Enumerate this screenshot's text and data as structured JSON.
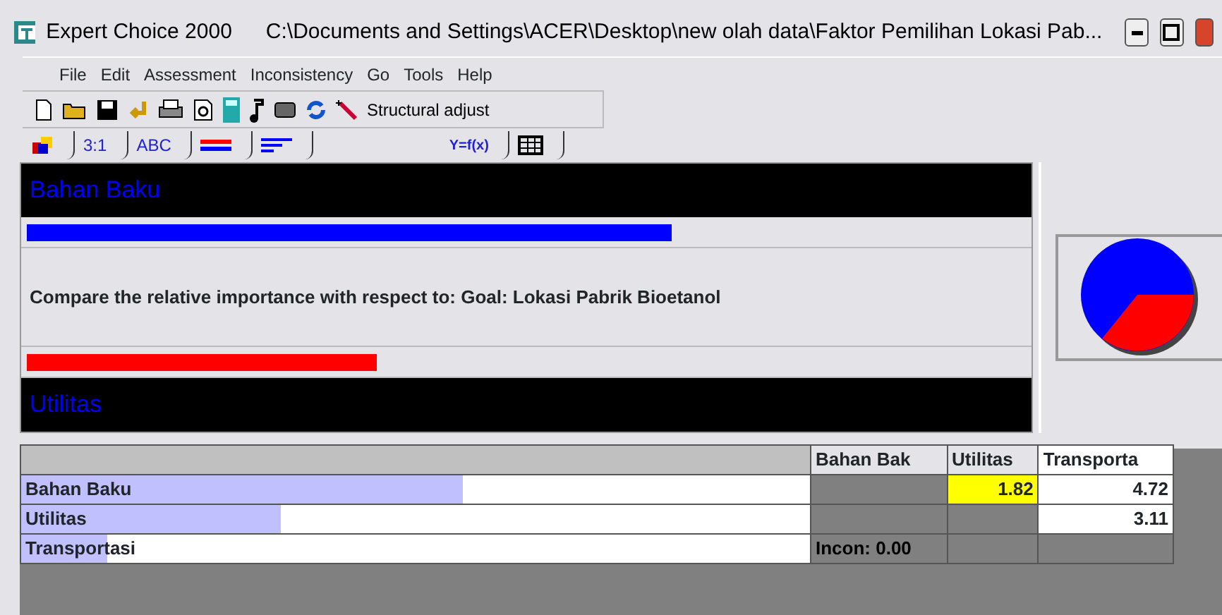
{
  "window": {
    "title": "Expert Choice 2000",
    "path": "C:\\Documents and Settings\\ACER\\Desktop\\new olah data\\Faktor Pemilihan Lokasi Pab..."
  },
  "menu": [
    "File",
    "Edit",
    "Assessment",
    "Inconsistency",
    "Go",
    "Tools",
    "Help"
  ],
  "toolbar": {
    "button": "Structural adjust"
  },
  "tabs": [
    {
      "kind": "icon"
    },
    {
      "kind": "text",
      "label": "3:1"
    },
    {
      "kind": "text",
      "label": "ABC"
    },
    {
      "kind": "bars"
    },
    {
      "kind": "lines"
    },
    {
      "kind": "text",
      "label": "Y=f(x)"
    },
    {
      "kind": "grid"
    }
  ],
  "comparison": {
    "top": {
      "label": "Bahan Baku",
      "level": 0.645
    },
    "question": "Compare the relative importance  with respect to: Goal: Lokasi Pabrik Bioetanol",
    "bottom": {
      "label": "Utilitas",
      "level": 0.35
    }
  },
  "matrix": {
    "columns": [
      "Bahan Bak",
      "Utilitas",
      "Transporta"
    ],
    "rows": [
      {
        "label": "Bahan Baku",
        "level": 0.56,
        "cells": [
          {
            "kind": "blank"
          },
          {
            "kind": "value",
            "text": "1.82",
            "selected": true
          },
          {
            "kind": "value",
            "text": "4.72",
            "selected": false
          }
        ]
      },
      {
        "label": "Utilitas",
        "level": 0.33,
        "cells": [
          {
            "kind": "blank"
          },
          {
            "kind": "blank"
          },
          {
            "kind": "value",
            "text": "3.11",
            "selected": false
          }
        ]
      },
      {
        "label": "Transportasi",
        "level": 0.11,
        "cells": [
          {
            "kind": "info",
            "text": "Incon: 0.00"
          },
          {
            "kind": "blank"
          },
          {
            "kind": "blank"
          }
        ]
      }
    ]
  }
}
